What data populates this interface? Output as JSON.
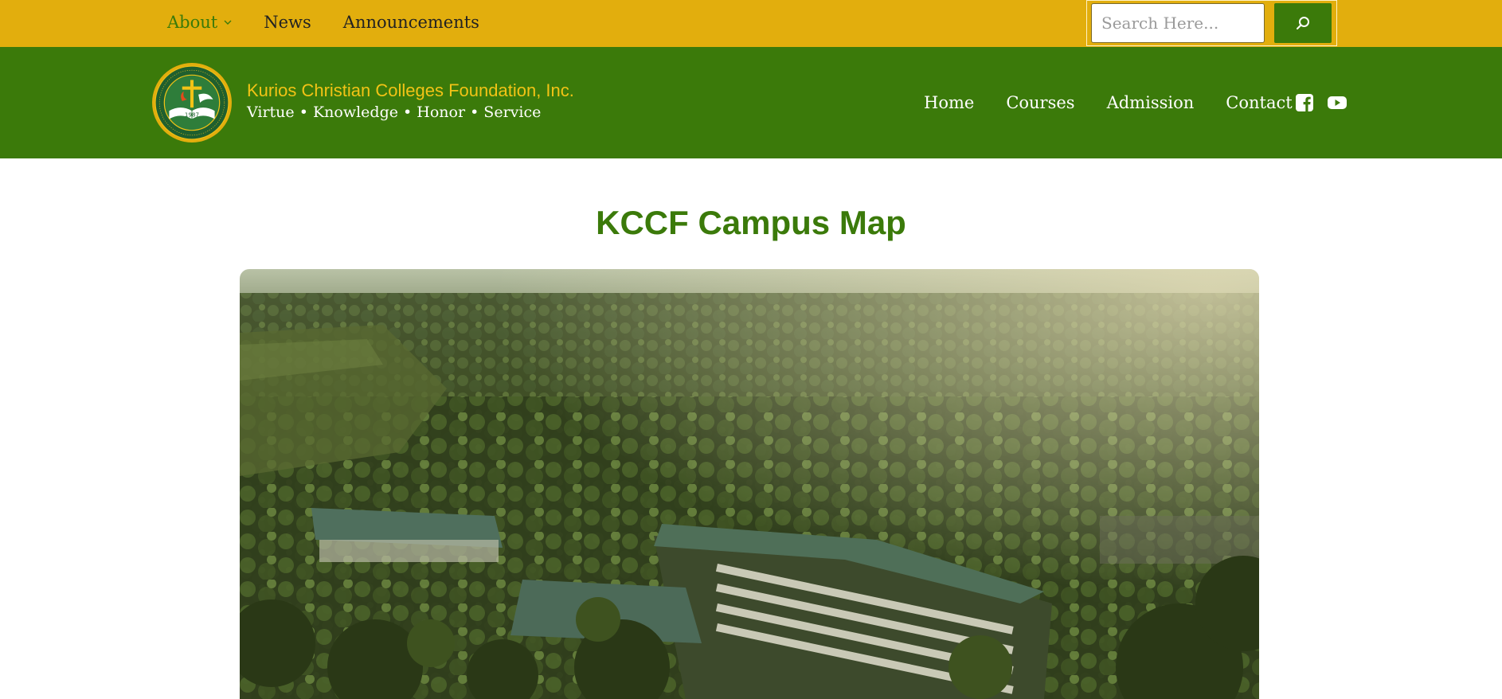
{
  "topbar": {
    "nav": [
      {
        "label": "About",
        "has_dropdown": true,
        "active": true
      },
      {
        "label": "News"
      },
      {
        "label": "Announcements"
      }
    ],
    "search": {
      "placeholder": "Search Here...",
      "button_icon": "search-icon"
    }
  },
  "header": {
    "logo_icon": "school-seal-icon",
    "logo_text": "1987",
    "brand_name": "Kurios Christian Colleges Foundation, Inc.",
    "tagline": "Virtue • Knowledge • Honor • Service",
    "nav": [
      {
        "label": "Home"
      },
      {
        "label": "Courses"
      },
      {
        "label": "Admission"
      },
      {
        "label": "Contact"
      }
    ],
    "social": [
      "facebook-icon",
      "youtube-icon"
    ]
  },
  "main": {
    "title": "KCCF Campus Map",
    "image_subject": "aerial-campus-photo"
  },
  "colors": {
    "topbar_bg": "#E2AE0D",
    "header_bg": "#3B7A0A",
    "brand_yellow": "#F2C316",
    "title_green": "#3B7A0A"
  }
}
